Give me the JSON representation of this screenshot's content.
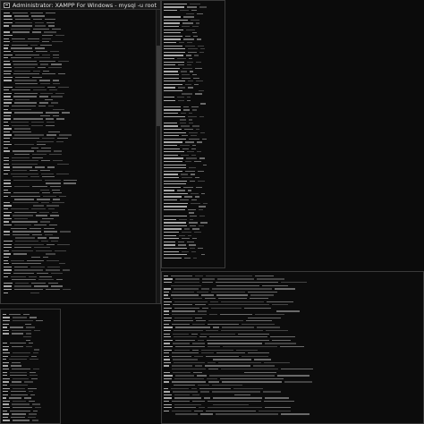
{
  "main_window": {
    "title": "Administrator: XAMPP For Windows - mysql -u root -p"
  },
  "colors": {
    "background": "#0b0b0b",
    "text": "#c0c0c0",
    "titlebar": "#1a1a1a",
    "border": "#3a3a3a"
  },
  "icons": [
    "cmd-icon"
  ]
}
